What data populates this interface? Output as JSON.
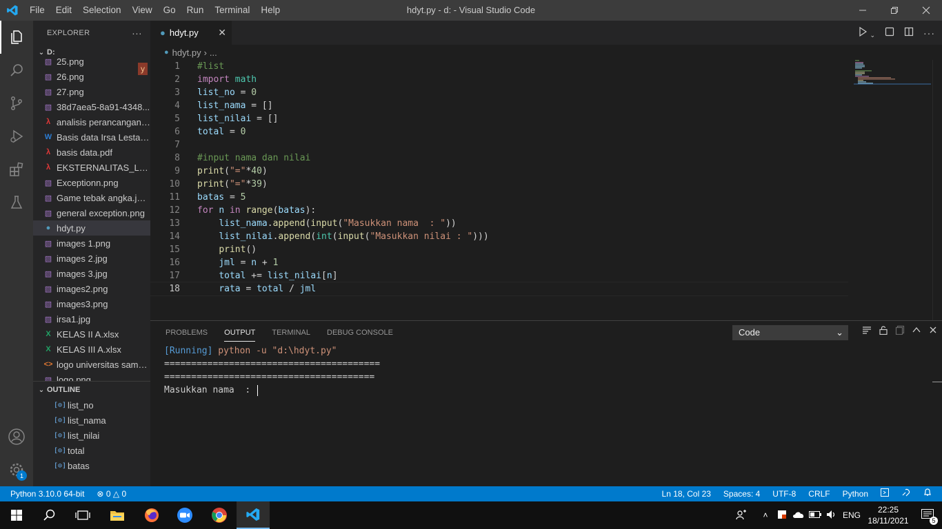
{
  "window": {
    "title": "hdyt.py - d: - Visual Studio Code"
  },
  "menu": [
    "File",
    "Edit",
    "Selection",
    "View",
    "Go",
    "Run",
    "Terminal",
    "Help"
  ],
  "activity_bar": {
    "accounts_badge": "1"
  },
  "sidebar": {
    "title": "EXPLORER",
    "more": "···",
    "root": "D:",
    "files": [
      {
        "name": "25.png",
        "type": "image"
      },
      {
        "name": "26.png",
        "type": "image"
      },
      {
        "name": "27.png",
        "type": "image"
      },
      {
        "name": "38d7aea5-8a91-4348...",
        "type": "image"
      },
      {
        "name": "analisis perancangan ...",
        "type": "pdf"
      },
      {
        "name": "Basis data Irsa Lestari...",
        "type": "word"
      },
      {
        "name": "basis data.pdf",
        "type": "pdf"
      },
      {
        "name": "EKSTERNALITAS_LING...",
        "type": "pdf"
      },
      {
        "name": "Exceptionn.png",
        "type": "image"
      },
      {
        "name": "Game tebak angka.jpeg",
        "type": "image"
      },
      {
        "name": "general exception.png",
        "type": "image"
      },
      {
        "name": "hdyt.py",
        "type": "python",
        "selected": true
      },
      {
        "name": "images 1.png",
        "type": "image"
      },
      {
        "name": "images 2.jpg",
        "type": "image"
      },
      {
        "name": "images 3.jpg",
        "type": "image"
      },
      {
        "name": "images2.png",
        "type": "image"
      },
      {
        "name": "images3.png",
        "type": "image"
      },
      {
        "name": "irsa1.jpg",
        "type": "image"
      },
      {
        "name": "KELAS II A.xlsx",
        "type": "excel"
      },
      {
        "name": "KELAS III A.xlsx",
        "type": "excel"
      },
      {
        "name": "logo universitas sama...",
        "type": "html"
      },
      {
        "name": "logo.png",
        "type": "image"
      }
    ],
    "y_badge": "y",
    "outline_title": "OUTLINE",
    "outline": [
      "list_no",
      "list_nama",
      "list_nilai",
      "total",
      "batas"
    ]
  },
  "editor": {
    "tab_label": "hdyt.py",
    "breadcrumb_file": "hdyt.py",
    "breadcrumb_rest": "...",
    "current_line": 18
  },
  "panel": {
    "tabs": [
      "PROBLEMS",
      "OUTPUT",
      "TERMINAL",
      "DEBUG CONSOLE"
    ],
    "active_tab": "OUTPUT",
    "channel": "Code",
    "output": {
      "running": "[Running]",
      "command": "python -u \"d:\\hdyt.py\"",
      "sep1": "========================================",
      "sep2": "=======================================",
      "prompt": "Masukkan nama  : "
    }
  },
  "status": {
    "interpreter": "Python 3.10.0 64-bit",
    "errors": "0",
    "warnings": "0",
    "position": "Ln 18, Col 23",
    "spaces": "Spaces: 4",
    "encoding": "UTF-8",
    "eol": "CRLF",
    "language": "Python"
  },
  "taskbar": {
    "lang": "ENG",
    "time": "22:25",
    "date": "18/11/2021",
    "notifications": "5"
  },
  "colors": {
    "accent": "#007acc",
    "keyword": "#c586c0",
    "comment": "#6a9955",
    "variable": "#9cdcfe",
    "function": "#dcdcaa",
    "string": "#ce9178",
    "number": "#b5cea8"
  }
}
